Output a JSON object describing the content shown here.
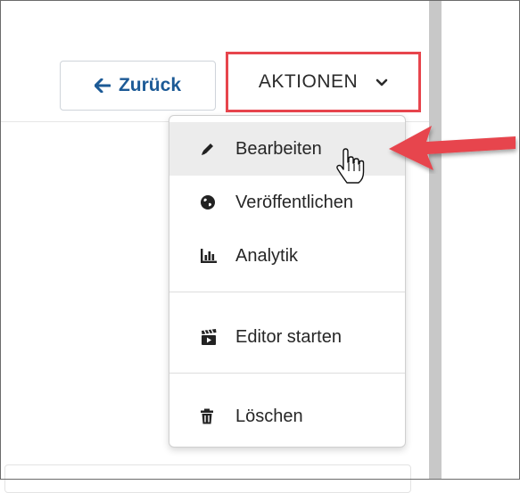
{
  "header": {
    "back_label": "Zurück",
    "actions_label": "AKTIONEN"
  },
  "menu": {
    "items": [
      {
        "label": "Bearbeiten",
        "icon": "pencil-icon"
      },
      {
        "label": "Veröffentlichen",
        "icon": "globe-icon"
      },
      {
        "label": "Analytik",
        "icon": "bar-chart-icon"
      },
      {
        "label": "Editor starten",
        "icon": "clapperboard-icon"
      },
      {
        "label": "Löschen",
        "icon": "trash-icon"
      }
    ]
  },
  "colors": {
    "link_blue": "#1c5a96",
    "highlight_red": "#e7454d",
    "divider_gray": "#c8c8c8"
  }
}
